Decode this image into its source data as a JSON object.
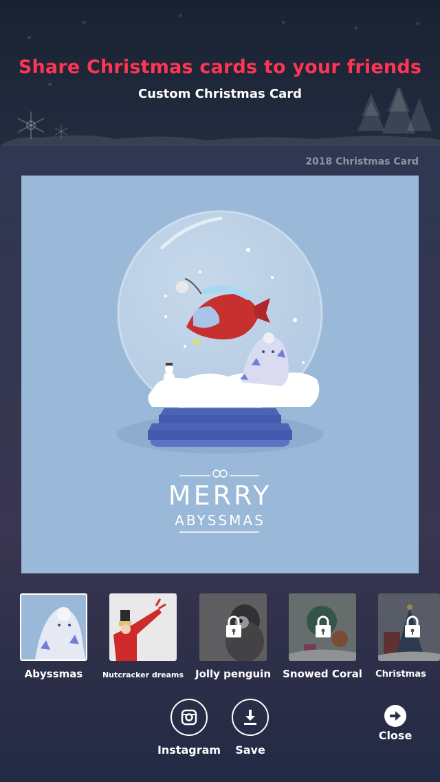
{
  "header": {
    "title": "Share Christmas cards to your friends",
    "subtitle": "Custom Christmas Card"
  },
  "card": {
    "year_label": "2018 Christmas Card",
    "greeting_line1": "MERRY",
    "greeting_line2": "ABYSSMAS",
    "background_color": "#9ab8d7"
  },
  "thumbnails": [
    {
      "label": "Abyssmas",
      "selected": true,
      "locked": false
    },
    {
      "label": "Nutcracker dreams",
      "selected": false,
      "locked": false
    },
    {
      "label": "Jolly penguin",
      "selected": false,
      "locked": true
    },
    {
      "label": "Snowed Coral",
      "selected": false,
      "locked": true
    },
    {
      "label": "Christmas",
      "selected": false,
      "locked": true
    }
  ],
  "actions": {
    "instagram_label": "Instagram",
    "save_label": "Save",
    "close_label": "Close"
  },
  "colors": {
    "title_accent": "#ff3553",
    "card_bg": "#9ab8d7",
    "globe_base": "#4d64b6"
  },
  "icons": [
    "snowflake-icon",
    "tree-icon",
    "lock-icon",
    "instagram-icon",
    "download-icon",
    "arrow-right-icon"
  ]
}
